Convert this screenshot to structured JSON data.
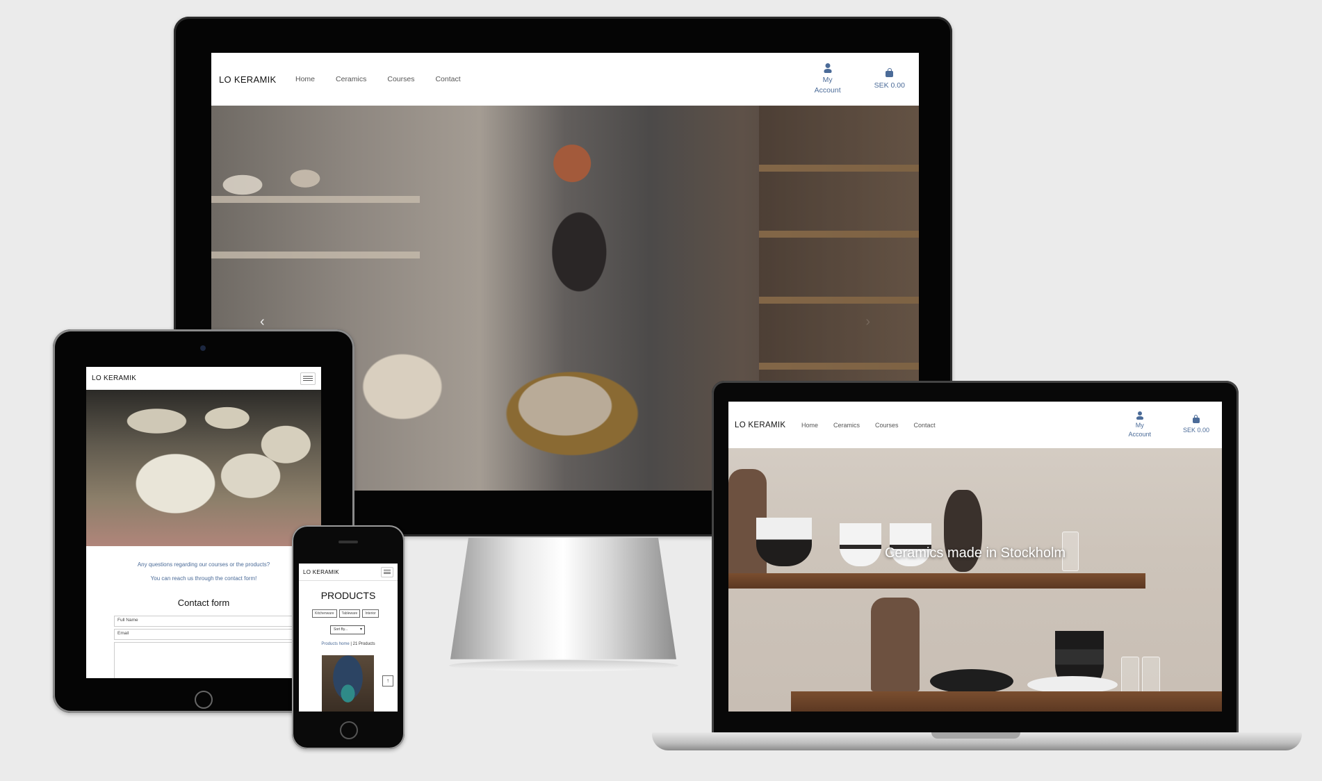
{
  "brand": "LO KERAMIK",
  "nav": {
    "links": [
      "Home",
      "Ceramics",
      "Courses",
      "Contact"
    ],
    "account_line1": "My",
    "account_line2": "Account",
    "cart_total": "SEK 0.00"
  },
  "desktop": {
    "carousel_prev": "‹",
    "carousel_next": "›"
  },
  "laptop": {
    "hero_caption": "Ceramics made in Stockholm"
  },
  "tablet": {
    "question_text": "Any questions regarding our courses or the products?",
    "contact_hint": "You can reach us through the contact form!",
    "form_title": "Contact form",
    "field_full_name": "Full Name",
    "field_email": "Email"
  },
  "phone": {
    "page_title": "PRODUCTS",
    "categories": [
      "Kitchenware",
      "Tableware",
      "Interior"
    ],
    "sort_placeholder": "Sort By...",
    "products_home_link": "Products home",
    "product_count": "21 Products",
    "back_to_top": "↑"
  },
  "colors": {
    "accent": "#4b6b98",
    "background": "#ebebeb",
    "device_bezel": "#050505"
  },
  "icons": [
    "user-icon",
    "shopping-bag-icon",
    "hamburger-icon",
    "chevron-left-icon",
    "chevron-right-icon",
    "arrow-up-icon"
  ]
}
